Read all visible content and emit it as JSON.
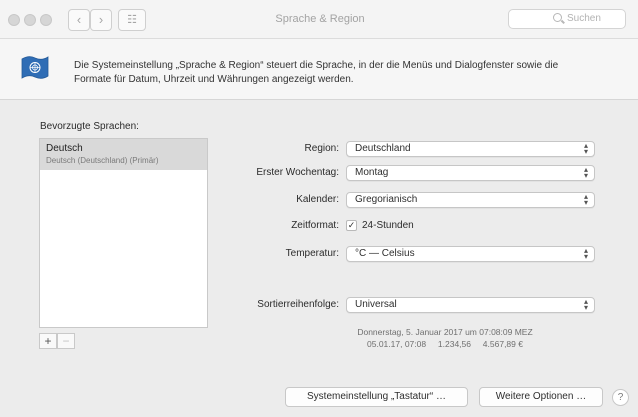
{
  "window": {
    "title": "Sprache & Region",
    "back_glyph": "‹",
    "forward_glyph": "›",
    "grid_glyph": "☷",
    "search_placeholder": "Suchen"
  },
  "header": {
    "icon": "un-flag-icon",
    "description": "Die Systemeinstellung „Sprache & Region“ steuert die Sprache, in der die Menüs und Dialogfenster sowie die Formate für Datum, Uhrzeit und Währungen angezeigt werden."
  },
  "languages": {
    "label": "Bevorzugte Sprachen:",
    "items": [
      {
        "name": "Deutsch",
        "detail": "Deutsch (Deutschland) (Primär)"
      }
    ],
    "add": "+",
    "remove": "−"
  },
  "settings": {
    "region": {
      "label": "Region:",
      "value": "Deutschland"
    },
    "first_weekday": {
      "label": "Erster Wochentag:",
      "value": "Montag"
    },
    "calendar": {
      "label": "Kalender:",
      "value": "Gregorianisch"
    },
    "time_format": {
      "label": "Zeitformat:",
      "option": "24-Stunden",
      "checked": true
    },
    "temperature": {
      "label": "Temperatur:",
      "value": "°C — Celsius"
    },
    "sort_order": {
      "label": "Sortierreihenfolge:",
      "value": "Universal"
    }
  },
  "sample": {
    "line1": "Donnerstag, 5. Januar 2017 um 07:08:09 MEZ",
    "line2": "05.01.17, 07:08     1.234,56     4.567,89 €"
  },
  "buttons": {
    "keyboard": "Systemeinstellung „Tastatur“ …",
    "advanced": "Weitere Optionen …",
    "help": "?"
  },
  "colors": {
    "window_bg": "#ececec",
    "selection": "#d9d9d9",
    "flag_blue": "#2f6db5"
  }
}
